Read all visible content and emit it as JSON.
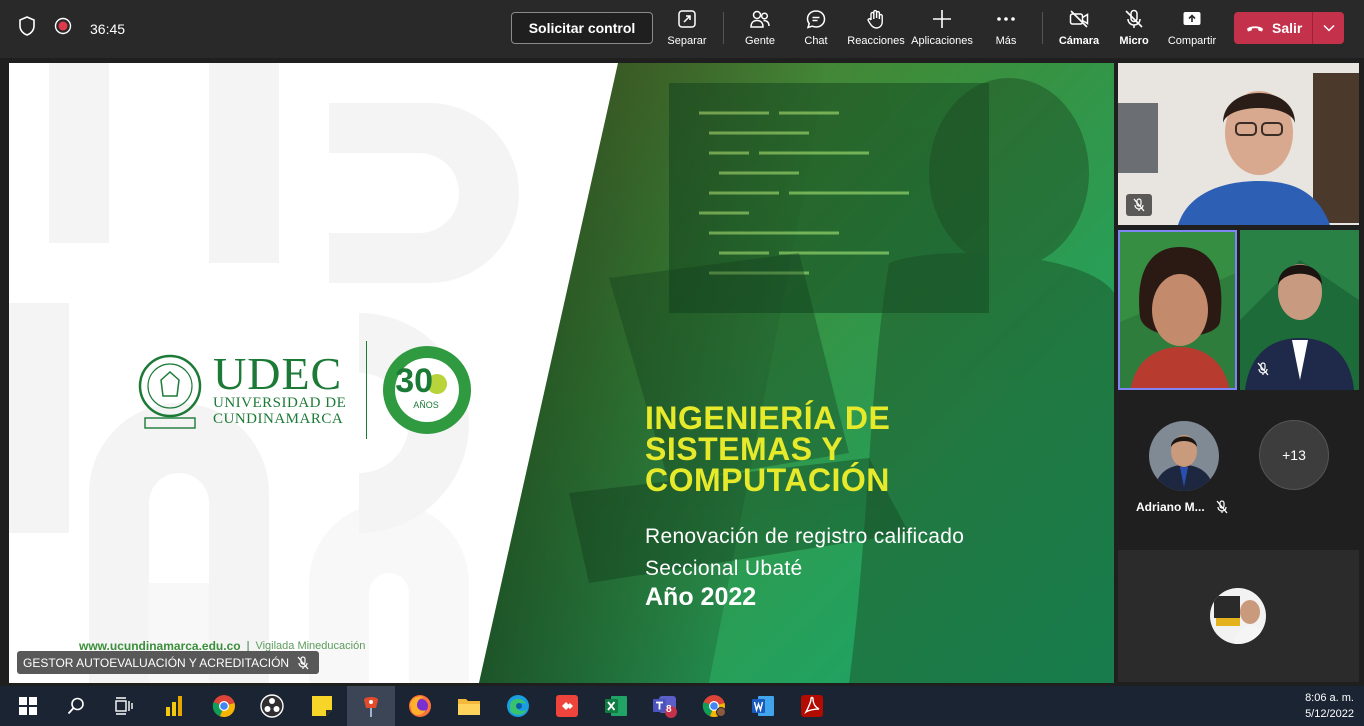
{
  "toolbar": {
    "timer": "36:45",
    "request_control": "Solicitar control",
    "buttons": {
      "separar": "Separar",
      "gente": "Gente",
      "chat": "Chat",
      "reacciones": "Reacciones",
      "aplicaciones": "Aplicaciones",
      "mas": "Más",
      "camara": "Cámara",
      "micro": "Micro",
      "compartir": "Compartir"
    },
    "leave": "Salir",
    "leave_color": "#c4314b"
  },
  "slide": {
    "logo_main": "UDEC",
    "logo_line1": "UNIVERSIDAD DE",
    "logo_line2": "CUNDINAMARCA",
    "anniv_number": "30",
    "anniv_word": "AÑOS",
    "title_line1": "INGENIERÍA DE",
    "title_line2": "SISTEMAS Y",
    "title_line3": "COMPUTACIÓN",
    "subtitle1": "Renovación de registro calificado",
    "subtitle2": "Seccional  Ubaté",
    "year": "Año 2022",
    "footer_url": "www.ucundinamarca.edu.co",
    "footer_sep": "|",
    "footer_note": "Vigilada Mineducación",
    "title_color": "#e7ea2a",
    "brand_green": "#1c7a37"
  },
  "presenter": {
    "label": "GESTOR AUTOEVALUACIÓN Y ACREDITACIÓN"
  },
  "participants": {
    "named": "Adriano M...",
    "overflow": "+13"
  },
  "taskbar": {
    "time": "8:06 a. m.",
    "date": "5/12/2022",
    "teams_badge": "8"
  }
}
